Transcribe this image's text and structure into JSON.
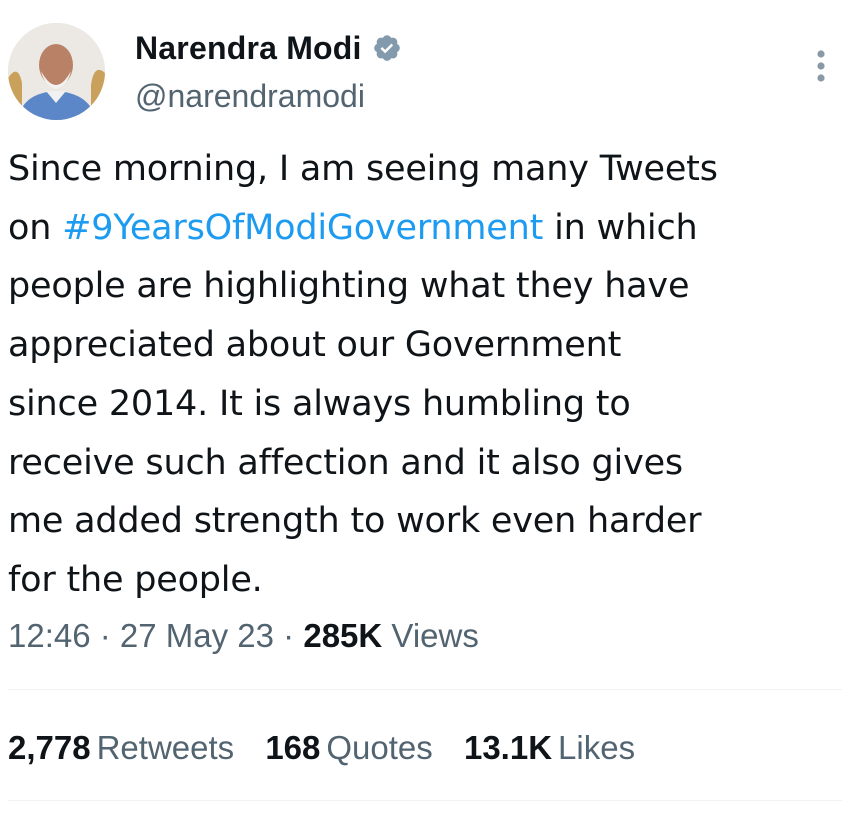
{
  "author": {
    "name": "Narendra Modi",
    "handle": "@narendramodi",
    "verified_color": "#829aab"
  },
  "tweet": {
    "lines": [
      "Since morning, I am seeing many Tweets",
      "on ",
      "#9YearsOfModiGovernment",
      " in which",
      "people are highlighting what they have",
      "appreciated about our Government",
      "since 2014. It is always humbling to",
      "receive such affection and it also gives",
      "me added strength to work even harder",
      "for the people."
    ],
    "hashtag_color": "#1d9bf0"
  },
  "meta": {
    "time": "12:46",
    "sep1": " · ",
    "date": "27 May 23",
    "sep2": " · ",
    "views_count": "285K",
    "views_label": "Views"
  },
  "stats": {
    "retweets_count": "2,778",
    "retweets_label": "Retweets",
    "quotes_count": "168",
    "quotes_label": "Quotes",
    "likes_count": "13.1K",
    "likes_label": "Likes"
  }
}
